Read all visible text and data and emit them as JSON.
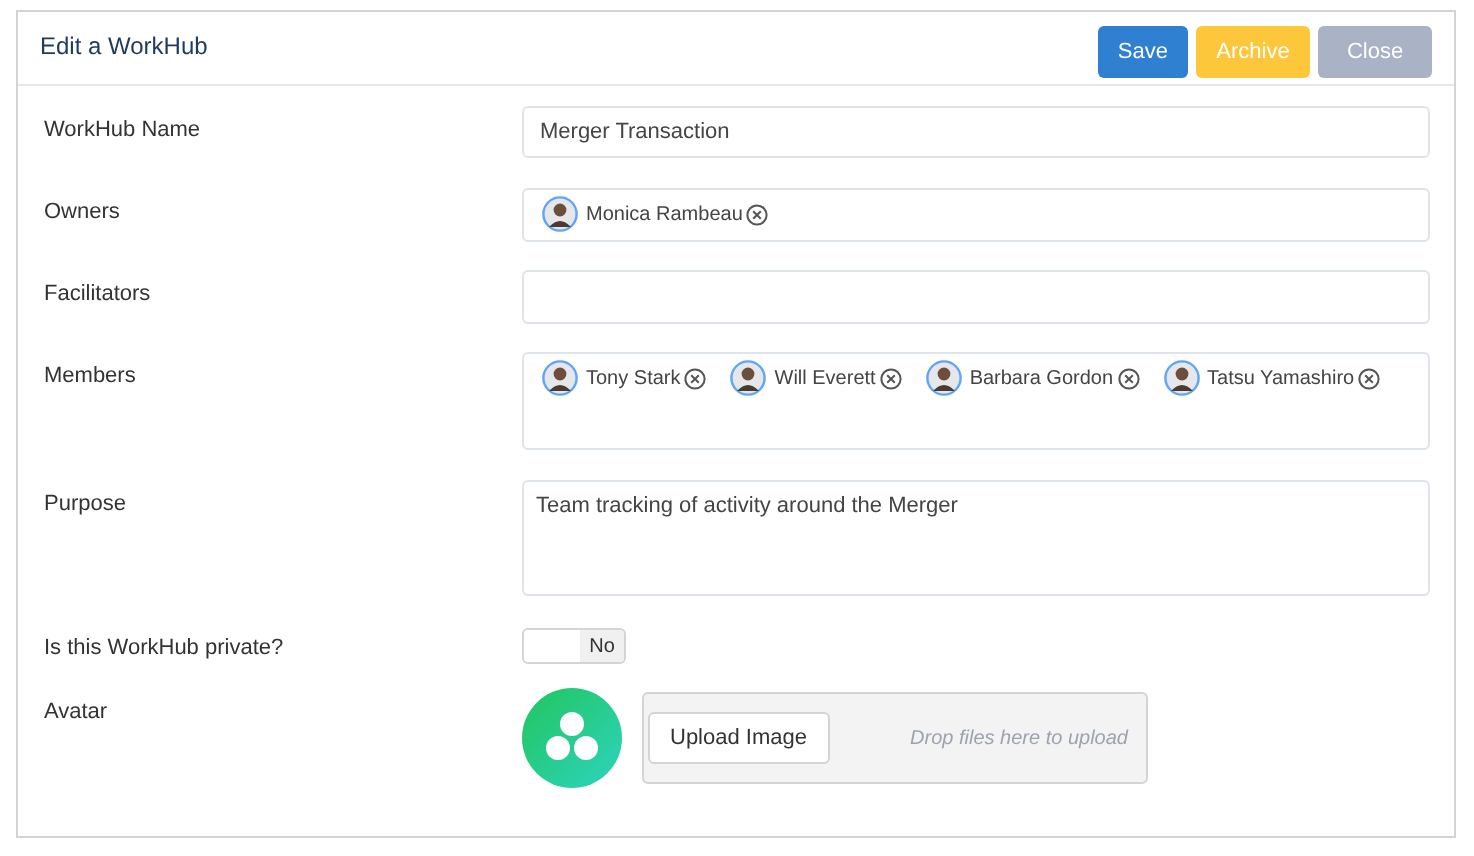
{
  "title": "Edit a WorkHub",
  "buttons": [
    {
      "label": "Save",
      "kind": "primary"
    },
    {
      "label": "Archive",
      "kind": "warning"
    },
    {
      "label": "Close",
      "kind": "muted"
    }
  ],
  "fields": [
    {
      "kind": "text",
      "label": "WorkHub Name",
      "value": "Merger Transaction"
    },
    {
      "kind": "people",
      "label": "Owners",
      "people": [
        "Monica Rambeau"
      ]
    },
    {
      "kind": "people",
      "label": "Facilitators"
    },
    {
      "kind": "people",
      "label": "Members",
      "people": [
        "Tony Stark",
        "Will Everett",
        "Barbara Gordon",
        "Tatsu Yamashiro"
      ]
    },
    {
      "kind": "textarea",
      "label": "Purpose",
      "value": "Team tracking of activity around the Merger"
    },
    {
      "kind": "toggle",
      "label": "Is this WorkHub private?",
      "on": false,
      "state_text": "No"
    },
    {
      "kind": "avatar",
      "label": "Avatar",
      "button": "Upload Image",
      "drop_hint": "Drop files here to upload"
    }
  ]
}
